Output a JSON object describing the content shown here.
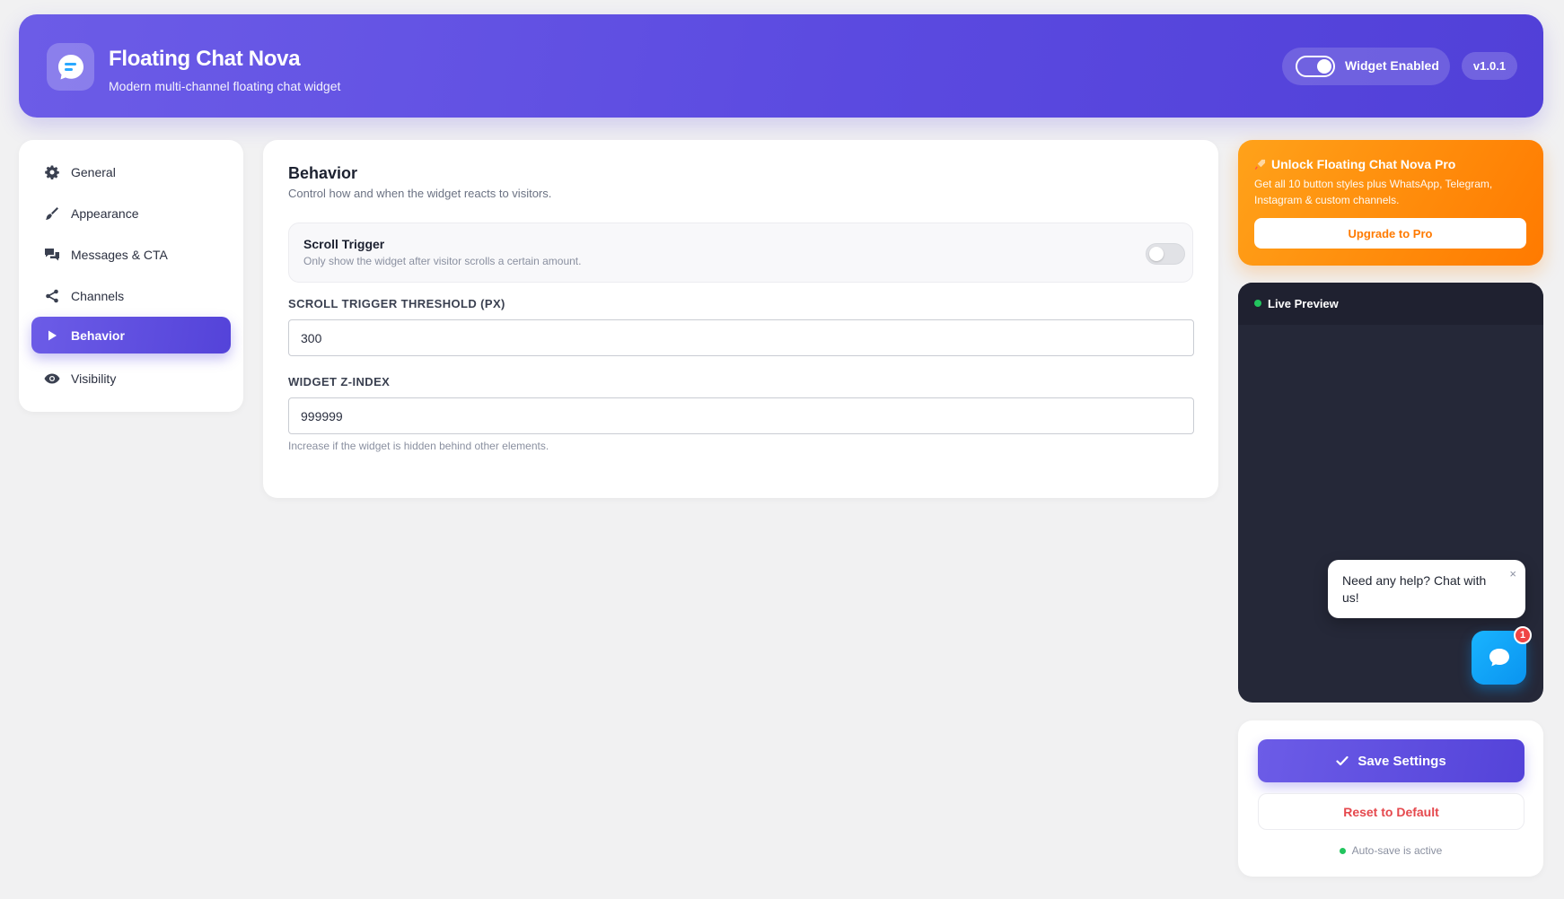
{
  "header": {
    "title": "Floating Chat Nova",
    "subtitle": "Modern multi-channel floating chat widget",
    "widget_enabled_label": "Widget Enabled",
    "widget_enabled": true,
    "version": "v1.0.1"
  },
  "sidebar": {
    "items": [
      {
        "label": "General",
        "icon": "gear-icon",
        "active": false
      },
      {
        "label": "Appearance",
        "icon": "paintbrush-icon",
        "active": false
      },
      {
        "label": "Messages & CTA",
        "icon": "chat-bubbles-icon",
        "active": false
      },
      {
        "label": "Channels",
        "icon": "share-icon",
        "active": false
      },
      {
        "label": "Behavior",
        "icon": "play-icon",
        "active": true
      },
      {
        "label": "Visibility",
        "icon": "eye-icon",
        "active": false
      }
    ]
  },
  "main": {
    "title": "Behavior",
    "subtitle": "Control how and when the widget reacts to visitors.",
    "scroll_trigger": {
      "title": "Scroll Trigger",
      "description": "Only show the widget after visitor scrolls a certain amount.",
      "enabled": false
    },
    "threshold": {
      "label": "SCROLL TRIGGER THRESHOLD (PX)",
      "value": "300"
    },
    "zindex": {
      "label": "WIDGET Z-INDEX",
      "value": "999999",
      "hint": "Increase if the widget is hidden behind other elements."
    }
  },
  "pro": {
    "title": "Unlock Floating Chat Nova Pro",
    "description": "Get all 10 button styles plus WhatsApp, Telegram, Instagram & custom channels.",
    "button_label": "Upgrade to Pro"
  },
  "preview": {
    "label": "Live Preview",
    "bubble_text": "Need any help? Chat with us!",
    "close_glyph": "×",
    "badge_count": "1"
  },
  "actions": {
    "save_label": "Save Settings",
    "reset_label": "Reset to Default",
    "autosave_text": "Auto-save is active"
  },
  "colors": {
    "accent": "#5b4ae0",
    "pro": "#ff8a0a",
    "launcher": "#0a94f0",
    "danger": "#e5484d",
    "success": "#22c55e"
  }
}
